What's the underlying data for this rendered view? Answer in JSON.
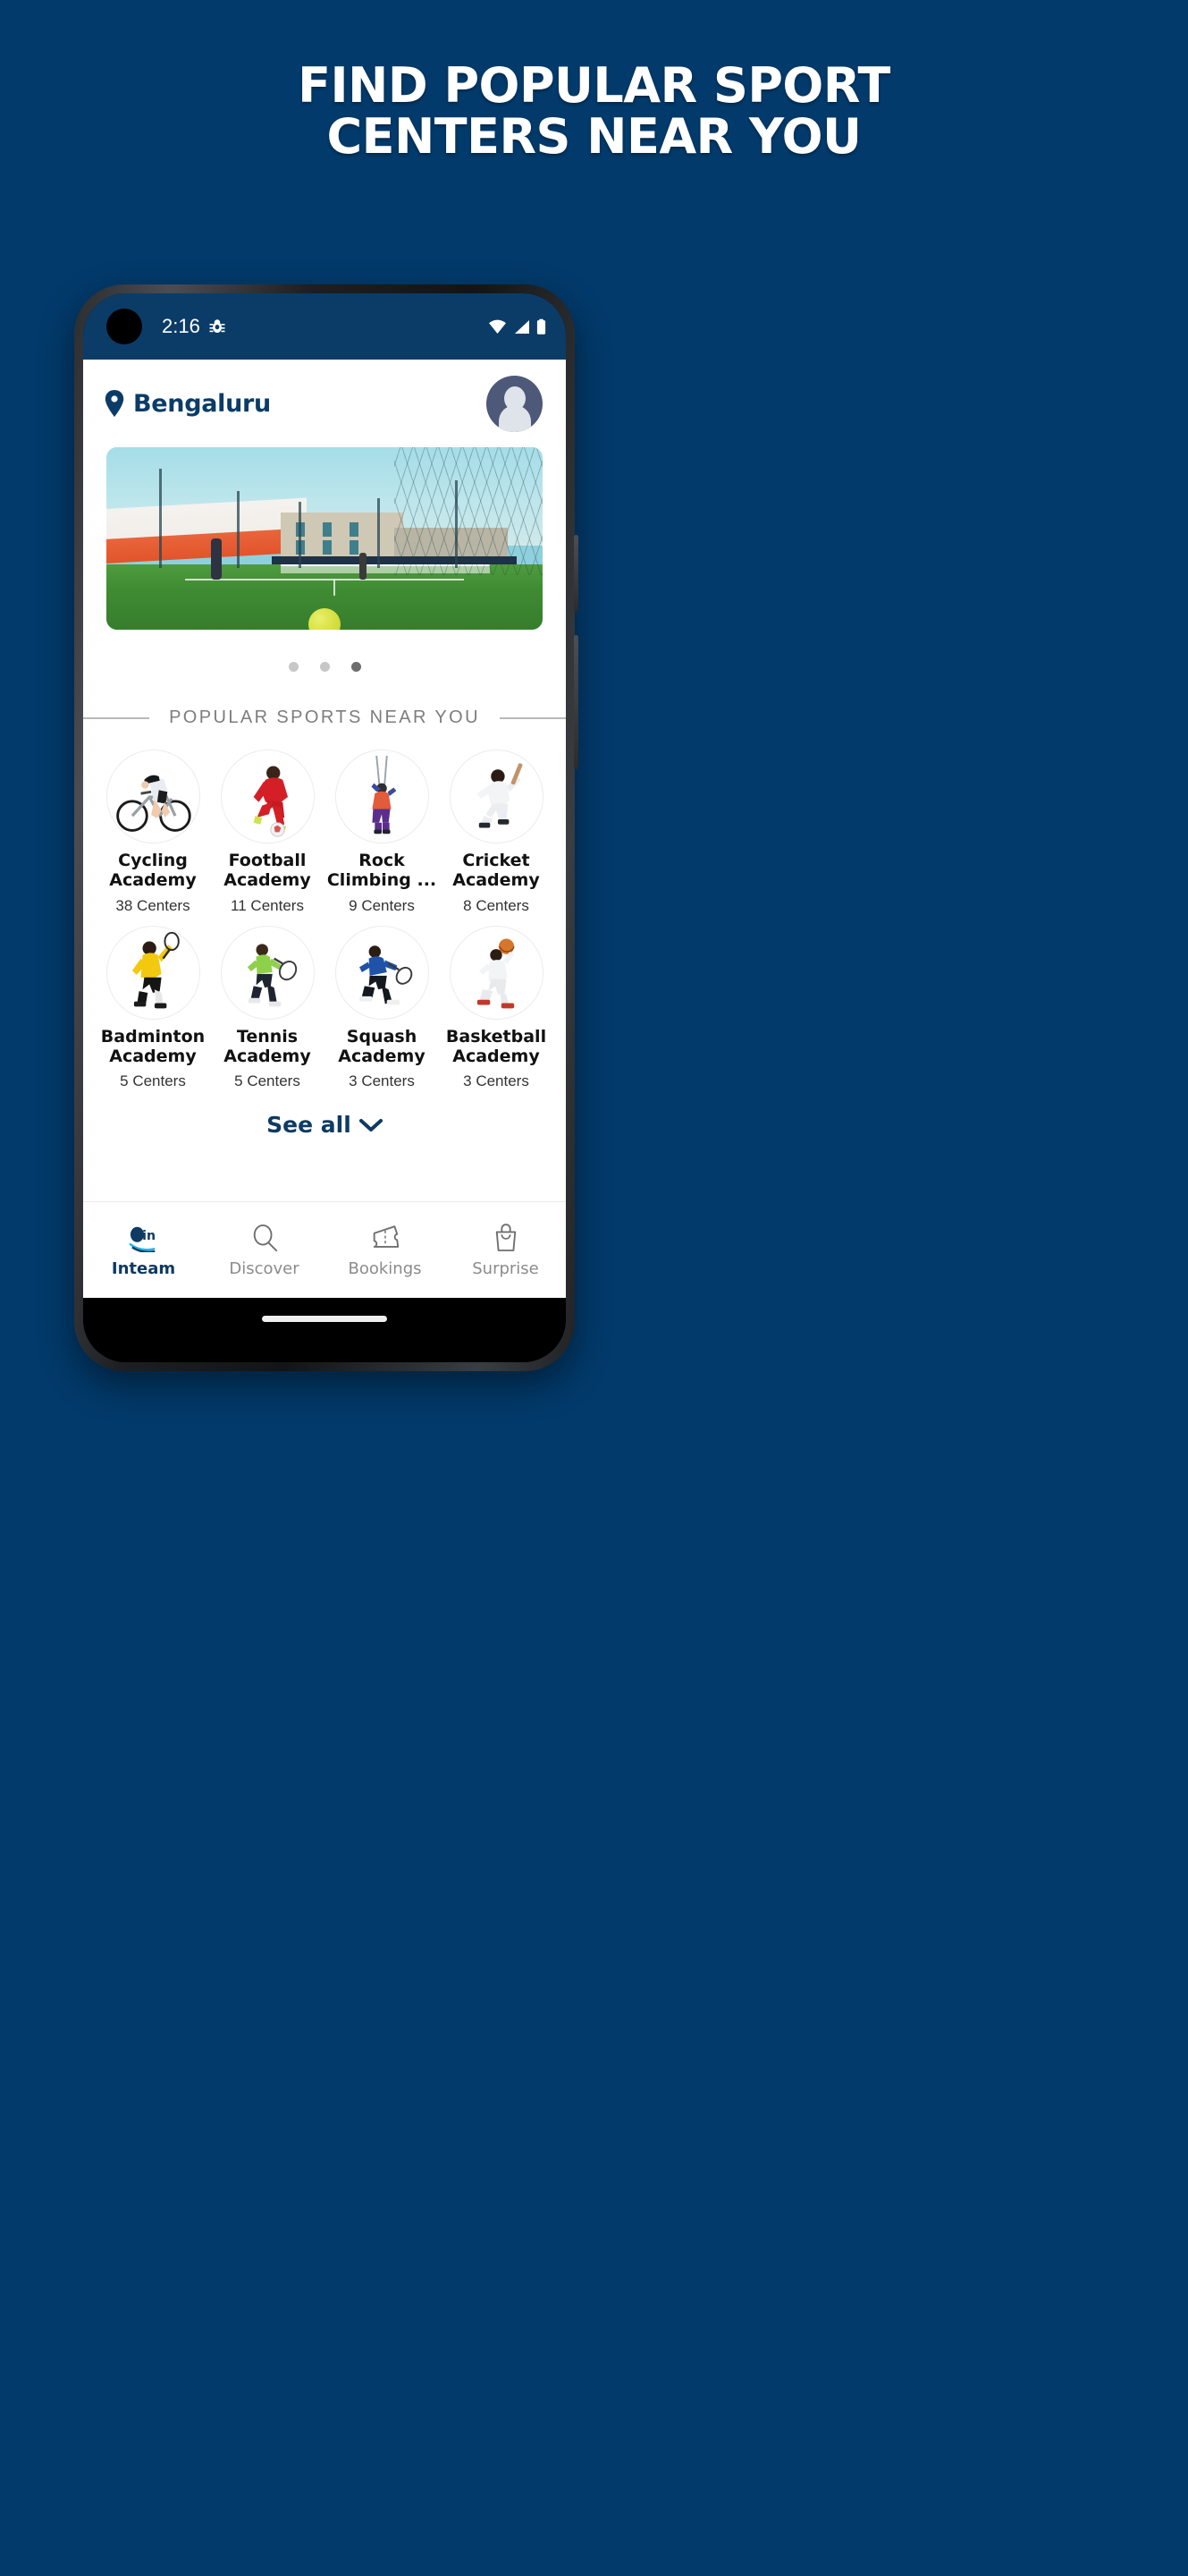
{
  "promo": {
    "headline_line1": "FIND POPULAR SPORT",
    "headline_line2": "CENTERS NEAR YOU",
    "background_color": "#023a6b",
    "text_color": "#ffffff"
  },
  "status_bar": {
    "time": "2:16",
    "debug_icon": "bug-icon",
    "wifi_icon": "wifi-icon",
    "signal_icon": "cellular-signal-icon",
    "battery_icon": "battery-icon",
    "background_color": "#0b3c68"
  },
  "app_header": {
    "location_icon": "location-pin-icon",
    "location": "Bengaluru",
    "avatar_icon": "user-avatar-icon",
    "accent_color": "#0b3c68"
  },
  "banner": {
    "alt": "tennis court with player and ball",
    "carousel": {
      "total_dots": 3,
      "active_index": 2
    }
  },
  "section": {
    "title": "POPULAR SPORTS NEAR YOU",
    "title_color": "#7d7d7d"
  },
  "sports": [
    {
      "name": "Cycling\nAcademy",
      "name_line1": "Cycling",
      "name_line2": "Academy",
      "centers": "38 Centers",
      "icon": "cyclist-photo"
    },
    {
      "name": "Football Academy",
      "name_line1": "Football",
      "name_line2": "Academy",
      "centers": "11 Centers",
      "icon": "footballer-photo"
    },
    {
      "name": "Rock Climbing ...",
      "name_line1": "Rock",
      "name_line2": "Climbing ...",
      "centers": "9 Centers",
      "icon": "rock-climber-photo"
    },
    {
      "name": "Cricket Academy",
      "name_line1": "Cricket",
      "name_line2": "Academy",
      "centers": "8 Centers",
      "icon": "cricketer-photo"
    },
    {
      "name": "Badminton Academy",
      "name_line1": "Badminton",
      "name_line2": "Academy",
      "centers": "5 Centers",
      "icon": "badminton-player-photo"
    },
    {
      "name": "Tennis Academy",
      "name_line1": "Tennis",
      "name_line2": "Academy",
      "centers": "5 Centers",
      "icon": "tennis-player-photo"
    },
    {
      "name": "Squash Academy",
      "name_line1": "Squash",
      "name_line2": "Academy",
      "centers": "3 Centers",
      "icon": "squash-player-photo"
    },
    {
      "name": "Basketball Academy",
      "name_line1": "Basketball",
      "name_line2": "Academy",
      "centers": "3 Centers",
      "icon": "basketball-player-photo"
    }
  ],
  "see_all": {
    "label": "See all",
    "icon": "chevron-down-icon",
    "color": "#0e3a63"
  },
  "bottom_nav": {
    "items": [
      {
        "label": "Inteam",
        "icon": "inteam-logo-icon",
        "active": true
      },
      {
        "label": "Discover",
        "icon": "search-icon",
        "active": false
      },
      {
        "label": "Bookings",
        "icon": "ticket-icon",
        "active": false
      },
      {
        "label": "Surprise",
        "icon": "shopping-bag-icon",
        "active": false
      }
    ],
    "active_color": "#0e3a63",
    "inactive_color": "#8b8b8b"
  }
}
